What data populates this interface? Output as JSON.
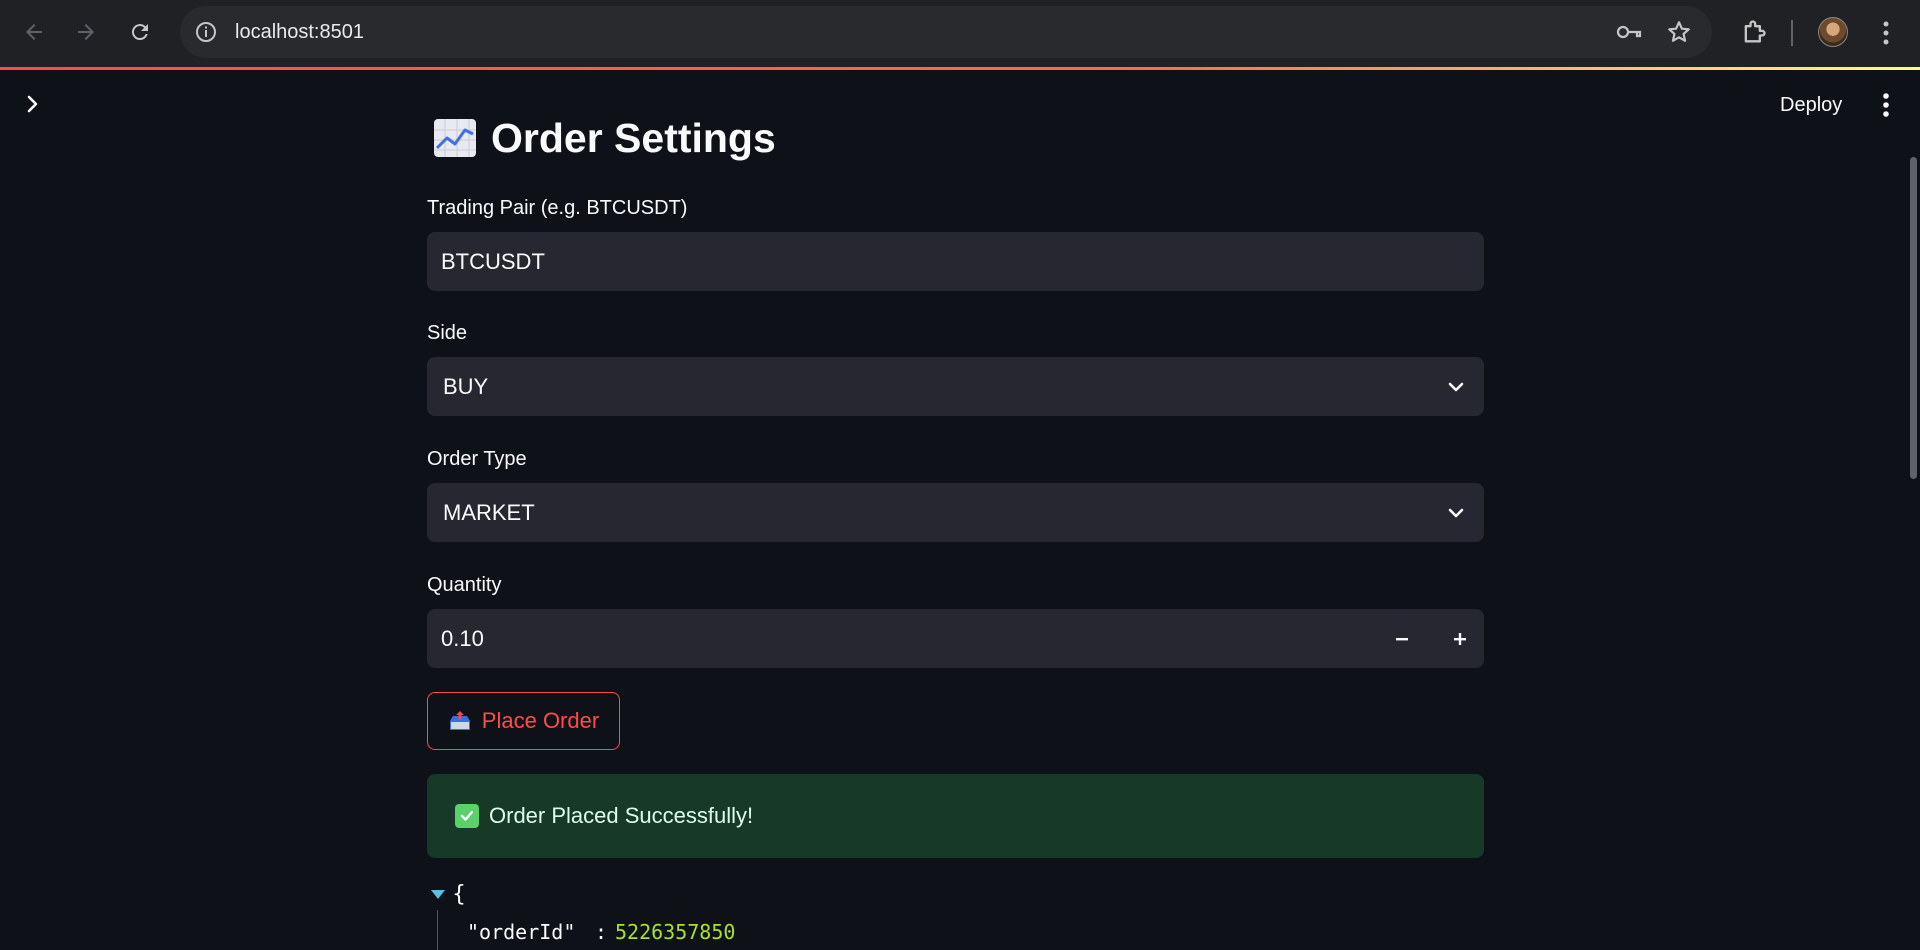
{
  "browser": {
    "url": "localhost:8501"
  },
  "app": {
    "deploy_label": "Deploy"
  },
  "page": {
    "title": "Order Settings"
  },
  "form": {
    "trading_pair": {
      "label": "Trading Pair (e.g. BTCUSDT)",
      "value": "BTCUSDT"
    },
    "side": {
      "label": "Side",
      "value": "BUY"
    },
    "order_type": {
      "label": "Order Type",
      "value": "MARKET"
    },
    "quantity": {
      "label": "Quantity",
      "value": "0.10",
      "minus": "−",
      "plus": "+"
    }
  },
  "place_order": {
    "label": "Place Order"
  },
  "alert": {
    "message": "Order Placed Successfully!"
  },
  "json_view": {
    "open_brace": "{",
    "key": "\"orderId\"",
    "colon": ":",
    "value": "5226357850"
  },
  "colors": {
    "accent": "#ff4b4b",
    "background": "#0e1117",
    "input_bg": "#262730",
    "success_bg": "#173928",
    "json_number": "#a6e22e"
  },
  "icons": [
    "back-icon",
    "forward-icon",
    "reload-icon",
    "info-icon",
    "key-icon",
    "star-icon",
    "extensions-icon",
    "kebab-icon",
    "chevron-right-icon",
    "chart-icon",
    "chevron-down-icon",
    "outbox-icon",
    "check-icon"
  ]
}
